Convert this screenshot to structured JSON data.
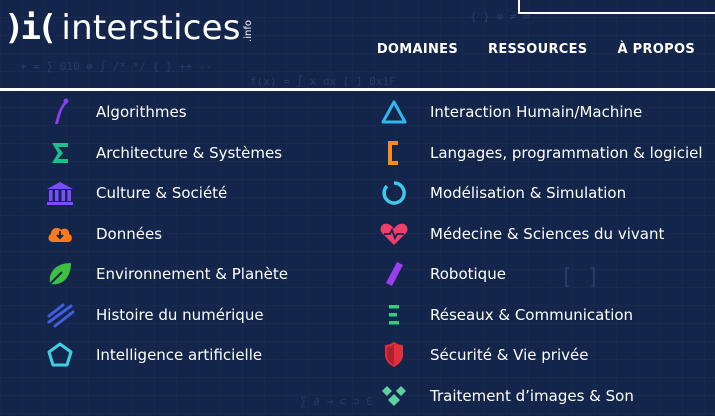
{
  "logo": {
    "mark": ")i(",
    "name": "interstices",
    "suffix": ".info"
  },
  "nav": {
    "items": [
      "DOMAINES",
      "RESSOURCES",
      "À PROPOS"
    ]
  },
  "domains": {
    "left": [
      {
        "label": "Algorithmes",
        "icon": "algorithm-icon",
        "color": "#8a3ff0"
      },
      {
        "label": "Architecture & Systèmes",
        "icon": "sigma-icon",
        "color": "#1bbf8a"
      },
      {
        "label": "Culture & Société",
        "icon": "institution-icon",
        "color": "#7b4dff"
      },
      {
        "label": "Données",
        "icon": "cloud-download-icon",
        "color": "#ff7a1a"
      },
      {
        "label": "Environnement & Planète",
        "icon": "leaf-icon",
        "color": "#3fbf3f"
      },
      {
        "label": "Histoire du numérique",
        "icon": "lines-icon",
        "color": "#3f5fe0"
      },
      {
        "label": "Intelligence artificielle",
        "icon": "pentagon-icon",
        "color": "#3fd0e8"
      }
    ],
    "right": [
      {
        "label": "Interaction Humain/Machine",
        "icon": "triangle-icon",
        "color": "#2fb8f0"
      },
      {
        "label": "Langages, programmation & logiciel",
        "icon": "bracket-icon",
        "color": "#ff8a1a"
      },
      {
        "label": "Modélisation & Simulation",
        "icon": "ring-icon",
        "color": "#3fc8e8"
      },
      {
        "label": "Médecine & Sciences du vivant",
        "icon": "heartbeat-icon",
        "color": "#f03f6a"
      },
      {
        "label": "Robotique",
        "icon": "bar-icon",
        "color": "#9a3ff0"
      },
      {
        "label": "Réseaux & Communication",
        "icon": "network-icon",
        "color": "#2fd07a"
      },
      {
        "label": "Sécurité & Vie privée",
        "icon": "shield-icon",
        "color": "#e02f3f"
      },
      {
        "label": "Traitement d’images & Son",
        "icon": "diamonds-icon",
        "color": "#5fd0a0"
      }
    ]
  }
}
